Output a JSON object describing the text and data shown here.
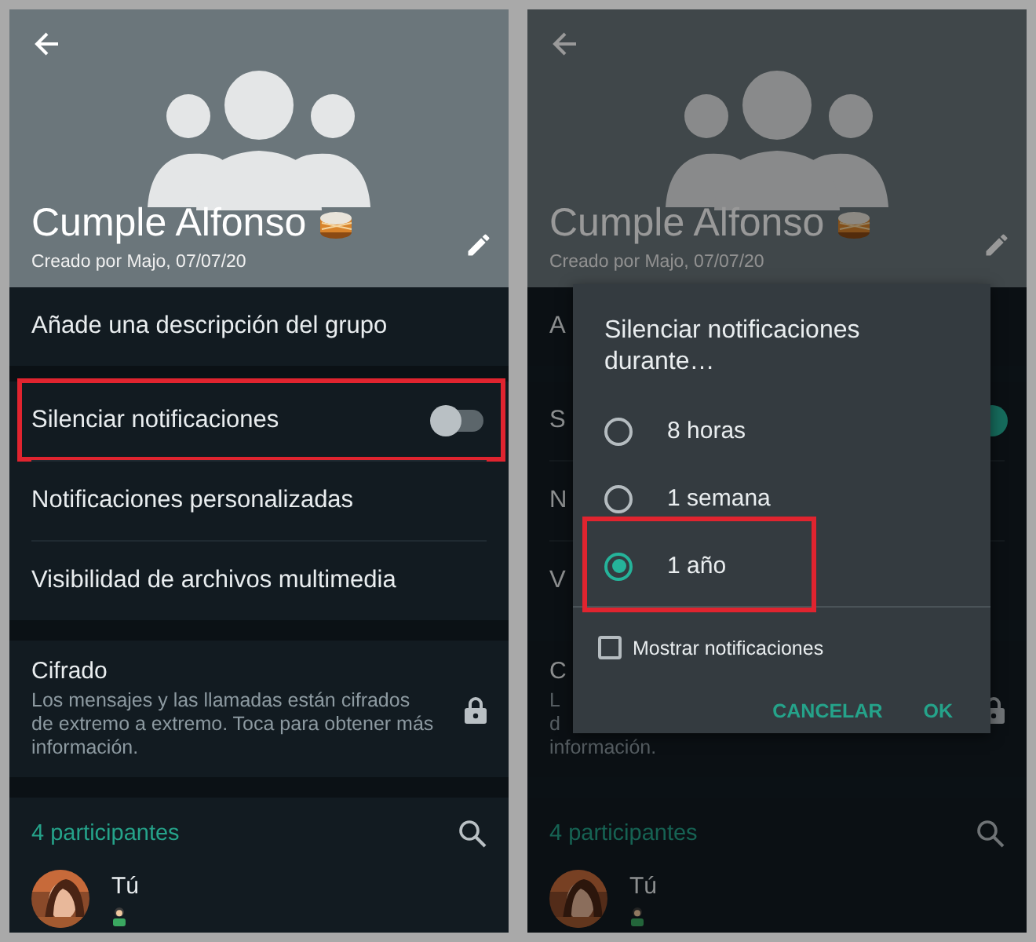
{
  "screens": [
    {
      "dimmed": false,
      "header": {
        "title": "Cumple Alfonso",
        "subtitle": "Creado por Majo, 07/07/20"
      },
      "description_row": "Añade una descripción del grupo",
      "settings": [
        {
          "label": "Silenciar notificaciones",
          "kind": "toggle",
          "on": false,
          "highlighted": true
        },
        {
          "label": "Notificaciones personalizadas",
          "kind": "text",
          "highlighted": false
        },
        {
          "label": "Visibilidad de archivos multimedia",
          "kind": "text",
          "highlighted": false
        }
      ],
      "encryption": {
        "title": "Cifrado",
        "lines": [
          "Los mensajes y las llamadas están cifrados",
          "de extremo a extremo. Toca para obtener más",
          "información."
        ]
      },
      "participants": {
        "count_label": "4 participantes",
        "members": [
          {
            "name": "Tú"
          }
        ]
      }
    },
    {
      "dimmed": true,
      "header": {
        "title": "Cumple Alfonso",
        "subtitle": "Creado por Majo, 07/07/20"
      },
      "description_row": "A",
      "settings": [
        {
          "label": "S",
          "kind": "toggle",
          "on": true,
          "highlighted": false
        },
        {
          "label": "N",
          "kind": "text",
          "highlighted": false
        },
        {
          "label": "V",
          "kind": "text",
          "highlighted": false
        }
      ],
      "encryption": {
        "title": "C",
        "lines": [
          "L",
          "d",
          "información."
        ]
      },
      "participants": {
        "count_label": "4 participantes",
        "members": [
          {
            "name": "Tú"
          }
        ]
      },
      "dialog": {
        "title": "Silenciar notificaciones durante…",
        "options": [
          {
            "label": "8 horas",
            "selected": false,
            "highlighted": false
          },
          {
            "label": "1 semana",
            "selected": false,
            "highlighted": false
          },
          {
            "label": "1 año",
            "selected": true,
            "highlighted": true
          }
        ],
        "checkbox": {
          "label": "Mostrar notificaciones",
          "checked": false
        },
        "buttons": [
          "CANCELAR",
          "OK"
        ]
      }
    }
  ]
}
